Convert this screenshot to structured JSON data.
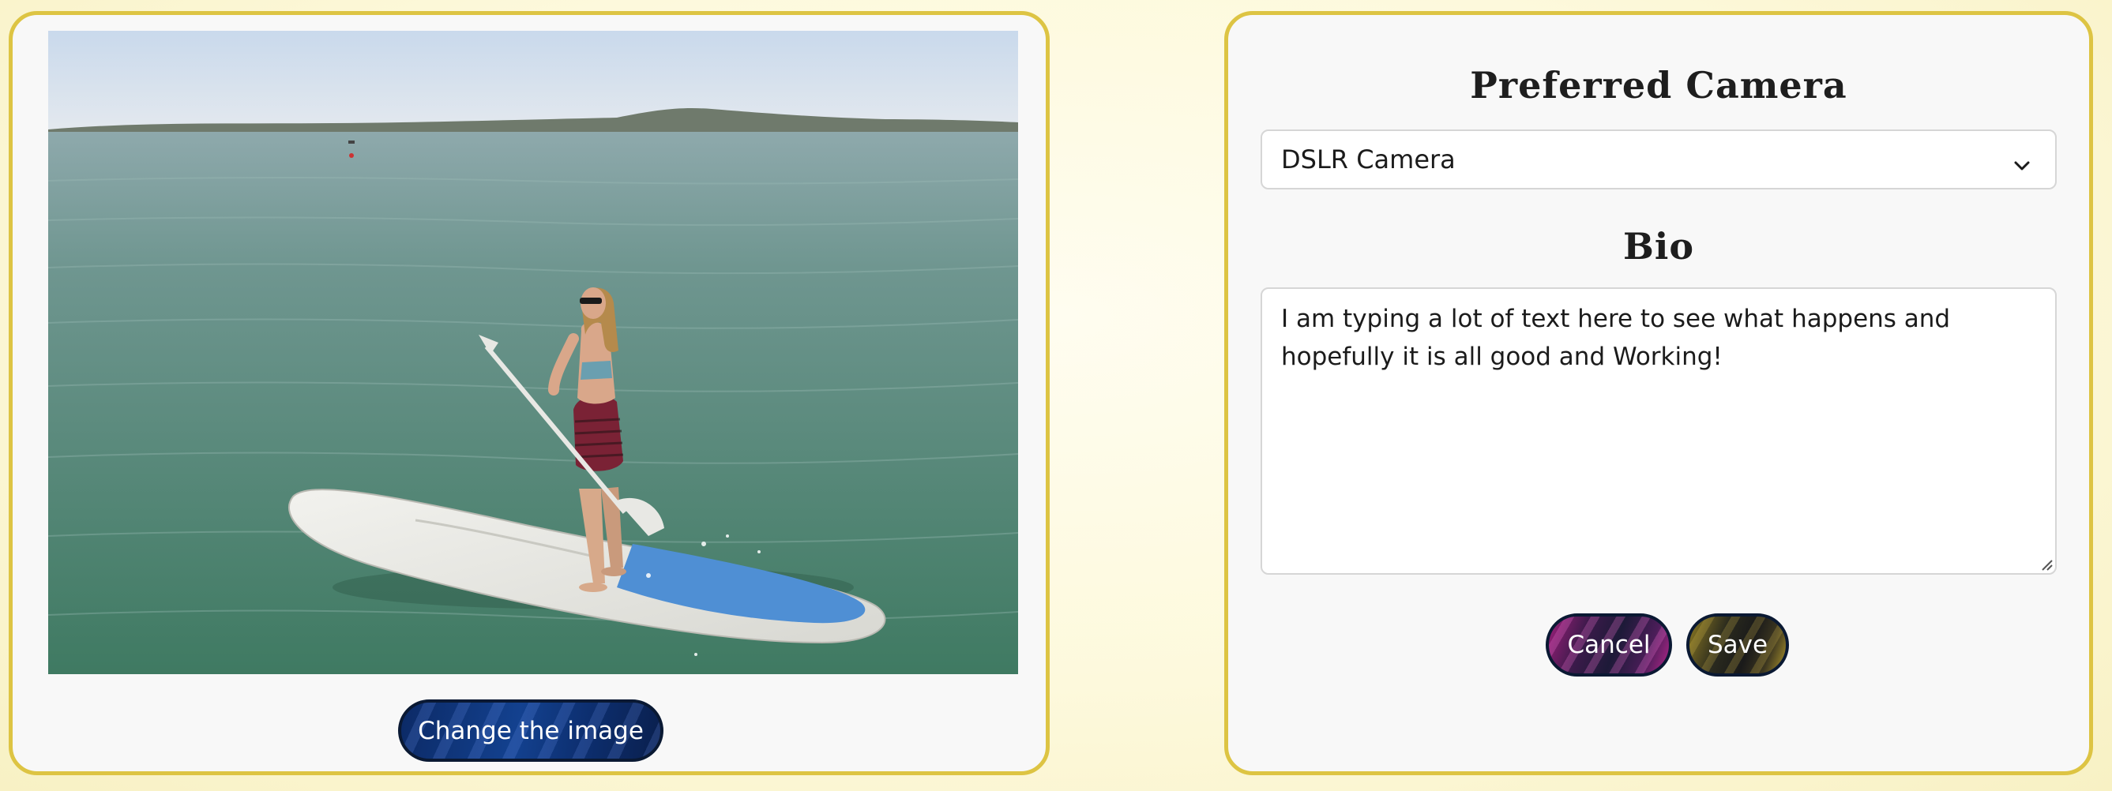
{
  "profile": {
    "photo_alt": "Woman standing on a paddle board on calm water",
    "change_image_label": "Change the image"
  },
  "form": {
    "camera_heading": "Preferred Camera",
    "camera_selected": "DSLR Camera",
    "bio_heading": "Bio",
    "bio_value": "I am typing a lot of text here to see what happens and hopefully it is all good and Working!",
    "cancel_label": "Cancel",
    "save_label": "Save"
  },
  "icons": {
    "select_arrow": "chevron-down-icon",
    "resize": "resize-grip-icon"
  },
  "colors": {
    "card_border": "#ddc443",
    "card_background": "#f8f8f8",
    "change_button": "#13418f",
    "cancel_accent": "#b3268a",
    "save_accent": "#b29a2e"
  }
}
